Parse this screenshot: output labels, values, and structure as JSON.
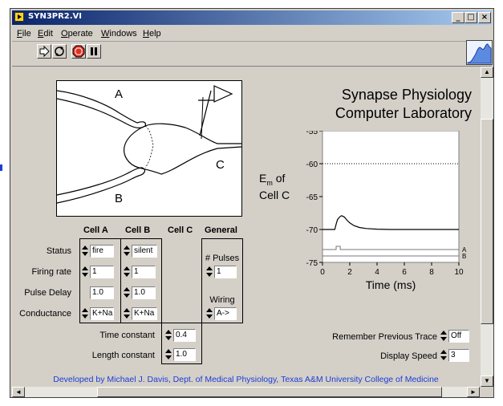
{
  "window": {
    "title": "SYN3PR2.VI",
    "controls": {
      "minimize": "_",
      "maximize": "□",
      "close": "×"
    }
  },
  "menu": [
    {
      "key": "F",
      "rest": "ile"
    },
    {
      "key": "E",
      "rest": "dit"
    },
    {
      "key": "O",
      "rest": "perate"
    },
    {
      "key": "W",
      "rest": "indows"
    },
    {
      "key": "H",
      "rest": "elp"
    }
  ],
  "toolbar": {
    "run_icon": "run-arrow-icon",
    "run_continuous_icon": "run-continuously-icon",
    "abort_icon": "abort-stop-icon",
    "pause_icon": "pause-icon"
  },
  "diagram": {
    "label_a": "A",
    "label_b": "B",
    "label_c": "C"
  },
  "header": {
    "line1": "Synapse Physiology",
    "line2": "Computer Laboratory"
  },
  "columns": {
    "a": "Cell A",
    "b": "Cell B",
    "c": "Cell C",
    "general": "General"
  },
  "rows": {
    "status": "Status",
    "firing_rate": "Firing rate",
    "pulse_delay": "Pulse Delay",
    "conductance": "Conductance"
  },
  "cell_a": {
    "status": "fire",
    "firing_rate": "1",
    "pulse_delay": "1.0",
    "conductance": "K+Na"
  },
  "cell_b": {
    "status": "silent",
    "firing_rate": "1",
    "pulse_delay": "1.0",
    "conductance": "K+Na"
  },
  "general": {
    "pulses_label": "# Pulses",
    "pulses": "1",
    "wiring_label": "Wiring",
    "wiring": "A->"
  },
  "cable": {
    "time_label": "Time constant",
    "time_value": "0.4",
    "length_label": "Length constant",
    "length_value": "1.0"
  },
  "chart_data": {
    "type": "line",
    "title": "",
    "ylabel_main": "E",
    "ylabel_sub": "m",
    "ylabel_of": " of",
    "ylabel_line2": "Cell C",
    "xlabel": "Time (ms)",
    "xlim": [
      0,
      10
    ],
    "ylim": [
      -75,
      -55
    ],
    "xticks": [
      "0",
      "2",
      "4",
      "6",
      "8",
      "10"
    ],
    "yticks": [
      "-55",
      "-60",
      "-65",
      "-70",
      "-75"
    ],
    "threshold": -60,
    "series": [
      {
        "x": [
          0,
          0.9,
          1.0,
          1.1,
          1.25,
          1.4,
          1.6,
          1.8,
          2.0,
          2.3,
          2.7,
          3.2,
          4.0,
          5.0,
          10
        ],
        "y": [
          -70,
          -70,
          -69.2,
          -68.5,
          -68.1,
          -67.9,
          -68.1,
          -68.6,
          -69.0,
          -69.4,
          -69.7,
          -69.85,
          -69.95,
          -70,
          -70
        ]
      }
    ],
    "trace_labels": {
      "a": "A",
      "b": "B"
    },
    "pulse_a": {
      "start": 1.0,
      "end": 1.3
    }
  },
  "options": {
    "remember_label": "Remember Previous Trace",
    "remember_value": "Off",
    "speed_label": "Display Speed",
    "speed_value": "3"
  },
  "credits": "Developed by Michael J. Davis, Dept. of Medical Physiology, Texas A&M University College of Medicine",
  "scroll": {
    "up": "▲",
    "down": "▼",
    "left": "◄",
    "right": "►"
  },
  "colors": {
    "title_bar": "#0a246a",
    "panel": "#d4d0c8",
    "credits": "#1c3cd8"
  }
}
